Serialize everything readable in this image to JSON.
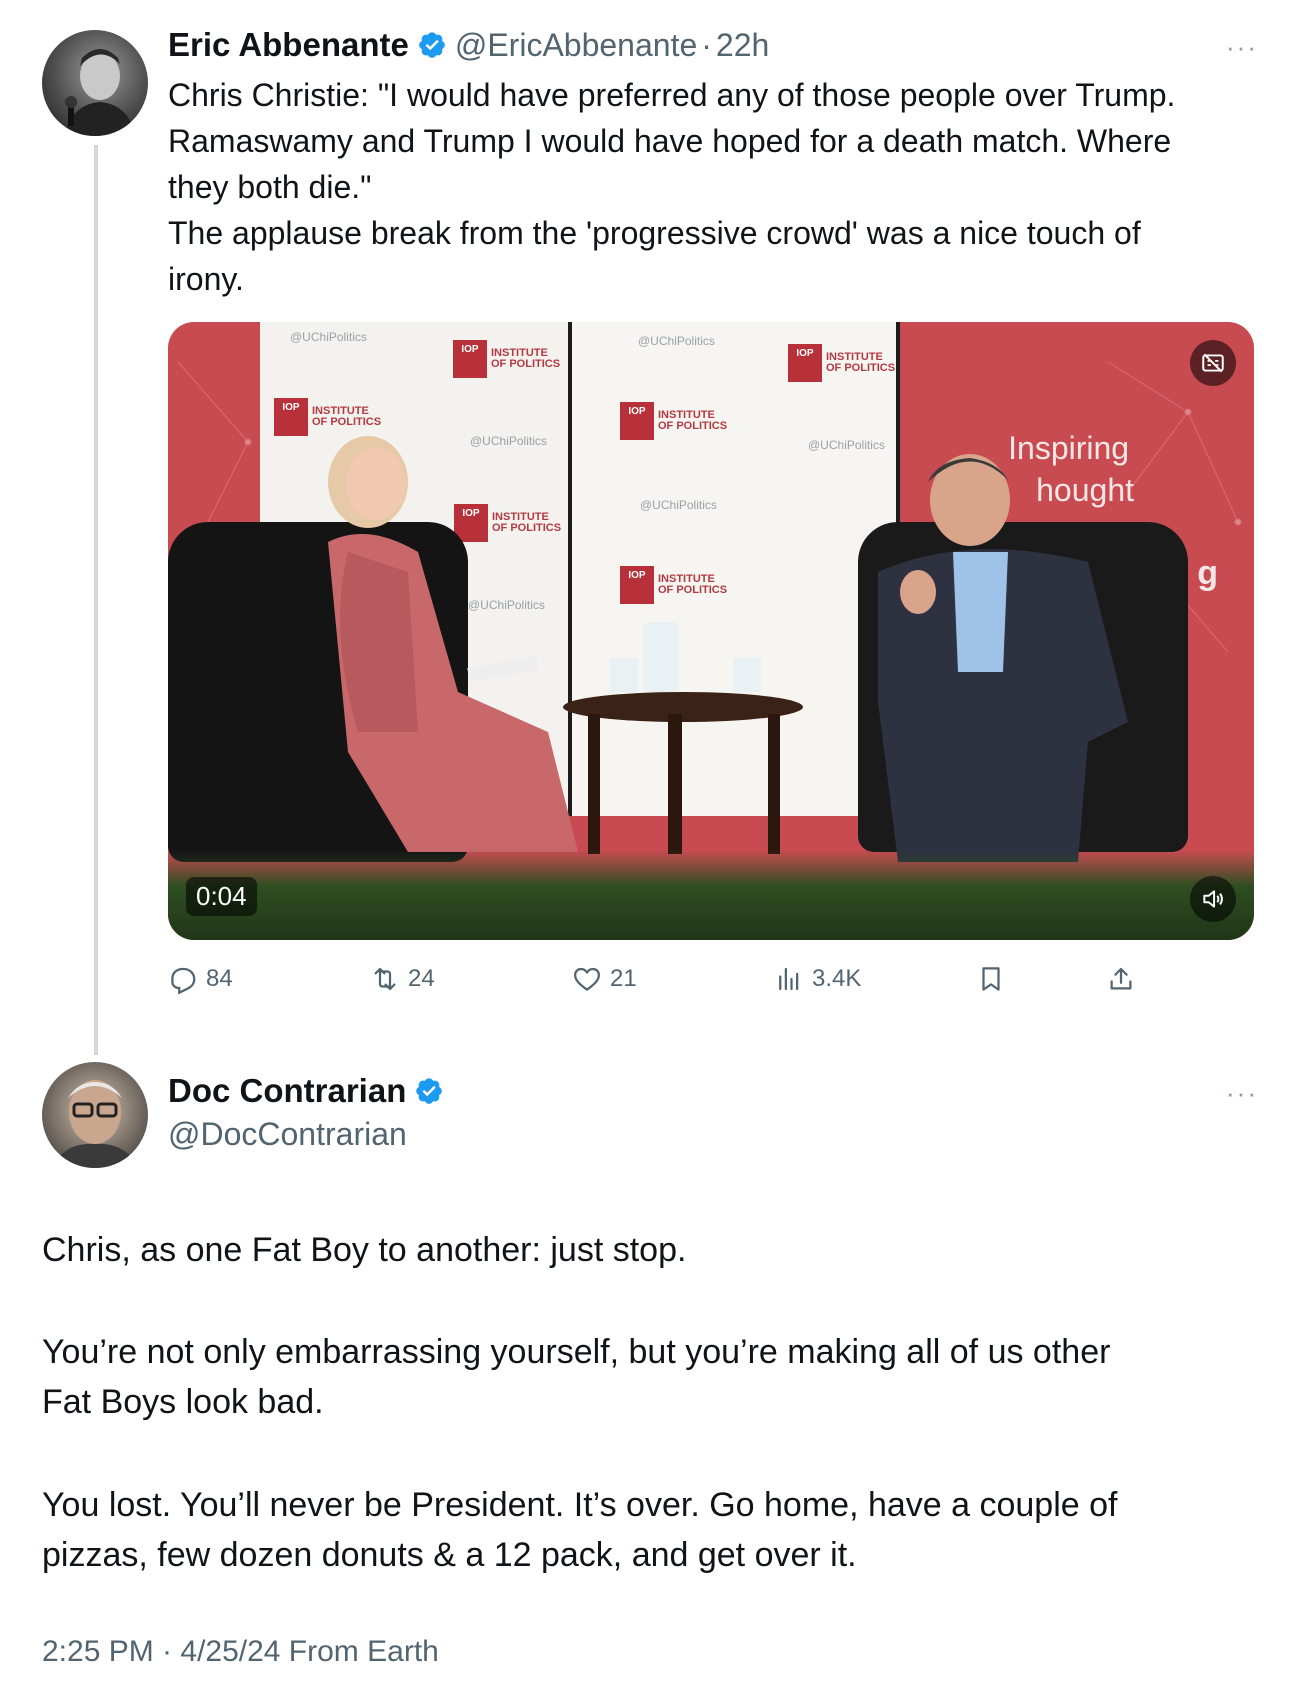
{
  "tweet1": {
    "author_name": "Eric Abbenante",
    "handle": "@EricAbbenante",
    "separator": "·",
    "time": "22h",
    "more": "···",
    "text_lines": [
      "Chris Christie: \"I would have preferred any of those people over Trump.",
      "Ramaswamy and Trump I would have hoped for a death match. Where",
      "they both die.\"",
      "The applause break from the 'progressive crowd' was a nice touch of",
      "irony."
    ],
    "media": {
      "duration": "0:04",
      "watermark": "@UChiPolitics",
      "logo_abbr": "IOP",
      "logo_text_1": "INSTITUTE",
      "logo_text_2": "OF POLITICS",
      "backdrop_text_1": "Inspiring",
      "backdrop_text_2": "hought",
      "backdrop_letter": "g"
    },
    "actions": {
      "replies": "84",
      "reposts": "24",
      "likes": "21",
      "views": "3.4K"
    }
  },
  "tweet2": {
    "author_name": "Doc Contrarian",
    "handle": "@DocContrarian",
    "more": "···",
    "paragraphs": [
      [
        "Chris, as one Fat Boy to another: just stop."
      ],
      [
        "You’re not only embarrassing yourself, but you’re making all of us other",
        "Fat Boys look bad."
      ],
      [
        "You lost. You’ll never be President. It’s over. Go home, have a couple of",
        "pizzas, few dozen donuts & a 12 pack, and get over it."
      ]
    ],
    "meta": "2:25 PM · 4/25/24 From Earth"
  },
  "colors": {
    "text": "#0f1419",
    "secondary": "#536471",
    "verified": "#1d9bf0",
    "thread_line": "#cfd9de",
    "backdrop_red": "#c94b52"
  }
}
